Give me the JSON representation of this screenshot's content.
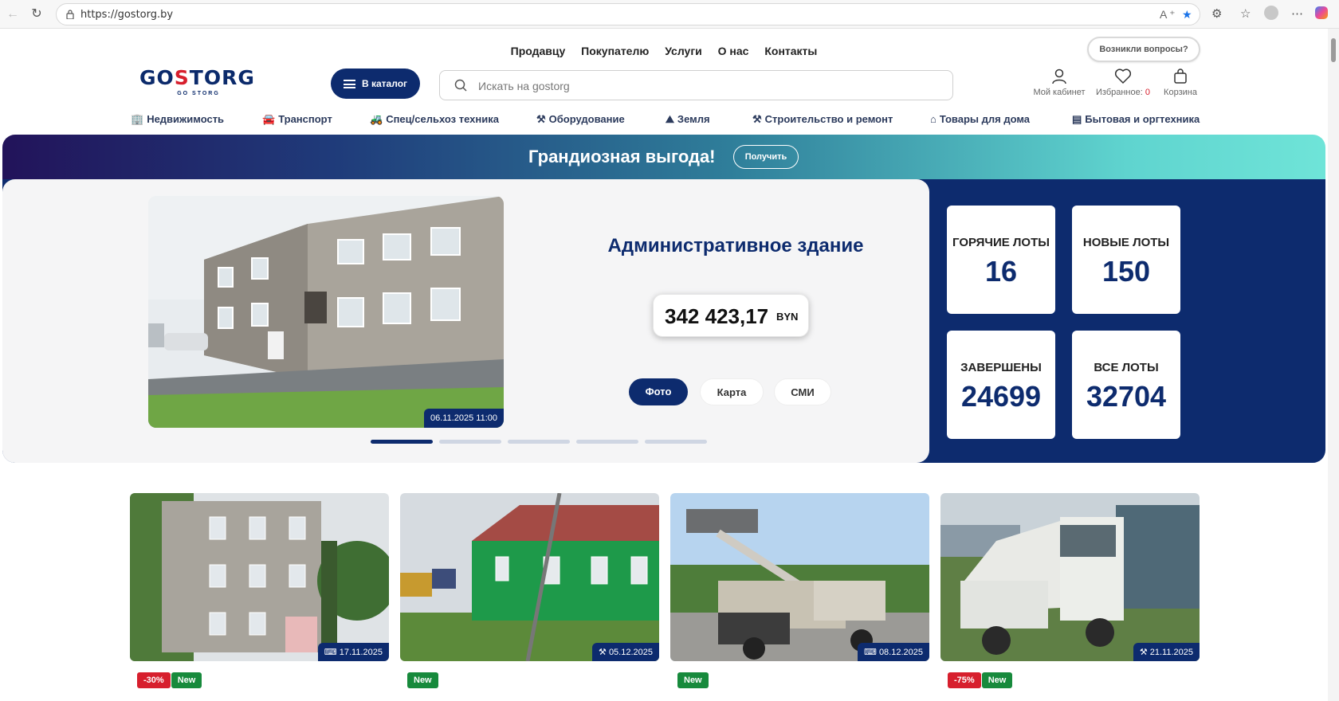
{
  "browser": {
    "url": "https://gostorg.by"
  },
  "header": {
    "nav": [
      "Продавцу",
      "Покупателю",
      "Услуги",
      "О нас",
      "Контакты"
    ],
    "questions_label": "Возникли вопросы?",
    "logo_text": "GOSTORG",
    "logo_sub": "GO STORG",
    "catalog_label": "В каталог",
    "search_placeholder": "Искать на gostorg",
    "account_label": "Мой кабинет",
    "favorites_label": "Избранное:",
    "favorites_count": "0",
    "cart_label": "Корзина"
  },
  "categories": [
    {
      "label": "Недвижимость",
      "icon": "building-icon"
    },
    {
      "label": "Транспорт",
      "icon": "car-icon"
    },
    {
      "label": "Спец/сельхоз техника",
      "icon": "tractor-icon"
    },
    {
      "label": "Оборудование",
      "icon": "tools-icon"
    },
    {
      "label": "Земля",
      "icon": "land-icon"
    },
    {
      "label": "Строительство и ремонт",
      "icon": "crane-icon"
    },
    {
      "label": "Товары для дома",
      "icon": "home-icon"
    },
    {
      "label": "Бытовая и оргтехника",
      "icon": "appliance-icon"
    }
  ],
  "promo": {
    "text": "Грандиозная выгода!",
    "button": "Получить"
  },
  "hero": {
    "title": "Административное здание",
    "price": "342 423,17",
    "currency": "BYN",
    "date": "06.11.2025 11:00",
    "tabs": [
      "Фото",
      "Карта",
      "СМИ"
    ],
    "active_tab": "Фото",
    "slides": 5,
    "active_slide": 1
  },
  "stats": [
    {
      "label": "ГОРЯЧИЕ ЛОТЫ",
      "value": "16"
    },
    {
      "label": "НОВЫЕ ЛОТЫ",
      "value": "150"
    },
    {
      "label": "ЗАВЕРШЕНЫ",
      "value": "24699"
    },
    {
      "label": "ВСЕ ЛОТЫ",
      "value": "32704"
    }
  ],
  "lots": [
    {
      "date": "17.11.2025",
      "icon": "auction-icon",
      "discount": "-30%",
      "new": "New"
    },
    {
      "date": "05.12.2025",
      "icon": "hammer-icon",
      "discount": "",
      "new": "New"
    },
    {
      "date": "08.12.2025",
      "icon": "auction-icon",
      "discount": "",
      "new": "New"
    },
    {
      "date": "21.11.2025",
      "icon": "hammer-icon",
      "discount": "-75%",
      "new": "New"
    }
  ],
  "colors": {
    "brand_navy": "#0d2b6e",
    "brand_red": "#d71f2d",
    "badge_green": "#178a3c"
  }
}
